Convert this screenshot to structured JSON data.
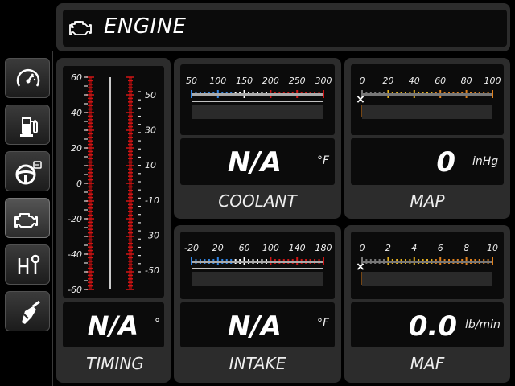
{
  "header": {
    "title": "ENGINE",
    "icon": "check-engine-icon"
  },
  "sidebar": {
    "items": [
      {
        "icon": "gauge-icon",
        "active": false
      },
      {
        "icon": "fuel-pump-icon",
        "active": false
      },
      {
        "icon": "steering-wheel-icon",
        "active": false
      },
      {
        "icon": "check-engine-icon",
        "active": true
      },
      {
        "icon": "gear-shift-icon",
        "active": false
      },
      {
        "icon": "fuel-nozzle-icon",
        "active": false
      }
    ]
  },
  "timing": {
    "label": "TIMING",
    "value": "N/A",
    "unit": "°",
    "left_scale": [
      "60",
      "40",
      "20",
      "0",
      "-20",
      "-40",
      "-60"
    ],
    "right_scale": [
      "50",
      "30",
      "10",
      "-10",
      "-30",
      "-50"
    ]
  },
  "coolant": {
    "label": "COOLANT",
    "value": "N/A",
    "unit": "°F",
    "scale": [
      "50",
      "100",
      "150",
      "200",
      "250",
      "300"
    ]
  },
  "intake": {
    "label": "INTAKE",
    "value": "N/A",
    "unit": "°F",
    "scale": [
      "-20",
      "20",
      "60",
      "100",
      "140",
      "180"
    ]
  },
  "map": {
    "label": "MAP",
    "value": "0",
    "unit": "inHg",
    "scale": [
      "0",
      "20",
      "40",
      "60",
      "80",
      "100"
    ]
  },
  "maf": {
    "label": "MAF",
    "value": "0.0",
    "unit": "lb/min",
    "scale": [
      "0",
      "2",
      "4",
      "6",
      "8",
      "10"
    ]
  },
  "colors": {
    "blue": "#2f86e8",
    "red": "#d21414",
    "orange": "#e0801c",
    "yellow": "#e8b21c",
    "panel": "#2c2c2c"
  }
}
